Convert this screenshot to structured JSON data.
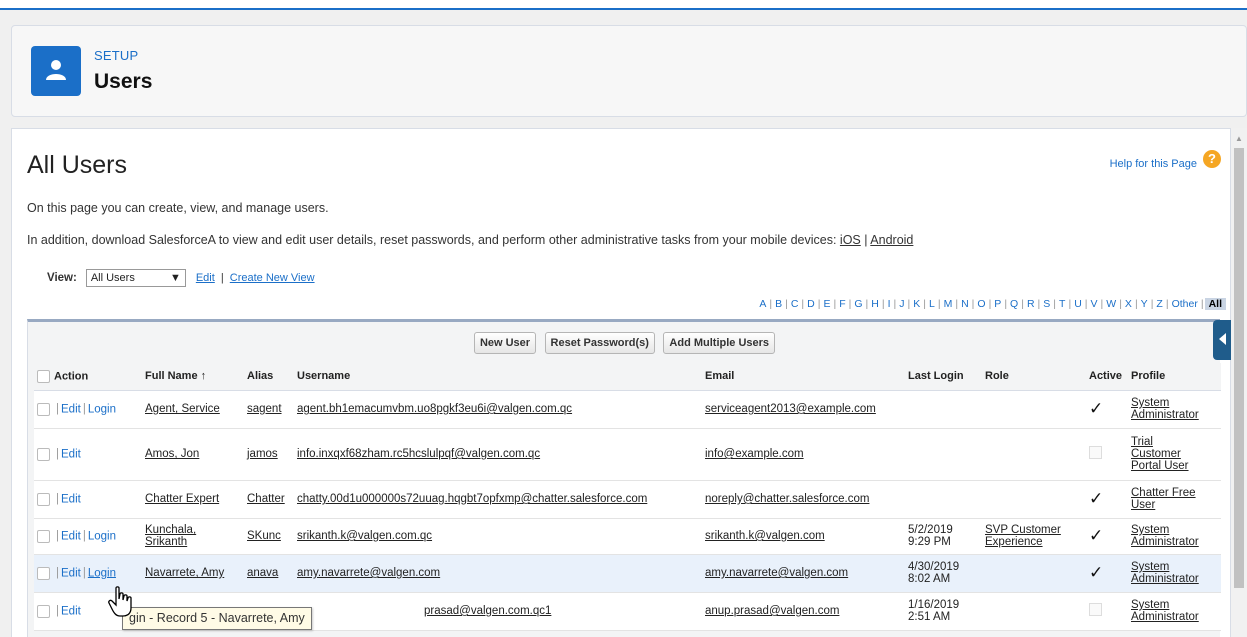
{
  "header": {
    "crumb": "SETUP",
    "title": "Users",
    "icon": "user-icon"
  },
  "page": {
    "title": "All Users",
    "help_label": "Help for this Page",
    "help_icon": "?",
    "desc1": "On this page you can create, view, and manage users.",
    "desc2_prefix": "In addition, download SalesforceA to view and edit user details, reset passwords, and perform other administrative tasks from your mobile devices:",
    "ios_label": "iOS",
    "android_label": "Android",
    "desc2_separator": "|"
  },
  "view": {
    "label": "View:",
    "selected": "All Users",
    "edit_label": "Edit",
    "create_label": "Create New View"
  },
  "alphabet": [
    "A",
    "B",
    "C",
    "D",
    "E",
    "F",
    "G",
    "H",
    "I",
    "J",
    "K",
    "L",
    "M",
    "N",
    "O",
    "P",
    "Q",
    "R",
    "S",
    "T",
    "U",
    "V",
    "W",
    "X",
    "Y",
    "Z",
    "Other",
    "All"
  ],
  "buttons": {
    "new_user": "New User",
    "reset_password": "Reset Password(s)",
    "add_multiple": "Add Multiple Users"
  },
  "columns": {
    "action": "Action",
    "full_name": "Full Name",
    "sort_icon": "↑",
    "alias": "Alias",
    "username": "Username",
    "email": "Email",
    "last_login": "Last Login",
    "role": "Role",
    "active": "Active",
    "profile": "Profile"
  },
  "action_labels": {
    "edit": "Edit",
    "login": "Login",
    "pipe": "|"
  },
  "rows": [
    {
      "full_name": "Agent, Service",
      "alias": "sagent",
      "username": "agent.bh1emacumvbm.uo8pgkf3eu6i@valgen.com.qc",
      "email": "serviceagent2013@example.com",
      "last_login_date": "",
      "last_login_time": "",
      "role_1": "",
      "role_2": "",
      "active": true,
      "profile_1": "System",
      "profile_2": "Administrator",
      "profile_3": ""
    },
    {
      "full_name": "Amos, Jon",
      "alias": "jamos",
      "username": "info.inxqxf68zham.rc5hcslulpqf@valgen.com.qc",
      "email": "info@example.com",
      "last_login_date": "",
      "last_login_time": "",
      "role_1": "",
      "role_2": "",
      "active": false,
      "profile_1": "Trial",
      "profile_2": "Customer",
      "profile_3": "Portal User"
    },
    {
      "full_name": "Chatter Expert",
      "alias": "Chatter",
      "username": "chatty.00d1u000000s72uuag.hqgbt7opfxmp@chatter.salesforce.com",
      "email": "noreply@chatter.salesforce.com",
      "last_login_date": "",
      "last_login_time": "",
      "role_1": "",
      "role_2": "",
      "active": true,
      "profile_1": "Chatter Free",
      "profile_2": "User",
      "profile_3": ""
    },
    {
      "full_name_1": "Kunchala,",
      "full_name_2": "Srikanth",
      "alias": "SKunc",
      "username": "srikanth.k@valgen.com.qc",
      "email": "srikanth.k@valgen.com",
      "last_login_date": "5/2/2019",
      "last_login_time": "9:29 PM",
      "role_1": "SVP Customer",
      "role_2": "Experience",
      "active": true,
      "profile_1": "System",
      "profile_2": "Administrator",
      "profile_3": ""
    },
    {
      "full_name": "Navarrete, Amy",
      "alias": "anava",
      "username": "amy.navarrete@valgen.com",
      "email": "amy.navarrete@valgen.com",
      "last_login_date": "4/30/2019",
      "last_login_time": "8:02 AM",
      "role_1": "",
      "role_2": "",
      "active": true,
      "profile_1": "System",
      "profile_2": "Administrator",
      "profile_3": ""
    },
    {
      "username_visible": "prasad@valgen.com.qc1",
      "email": "anup.prasad@valgen.com",
      "last_login_date": "1/16/2019",
      "last_login_time": "2:51 AM",
      "role_1": "",
      "role_2": "",
      "active": false,
      "profile_1": "System",
      "profile_2": "Administrator",
      "profile_3": ""
    }
  ],
  "tooltip": "gin - Record 5 - Navarrete, Amy"
}
